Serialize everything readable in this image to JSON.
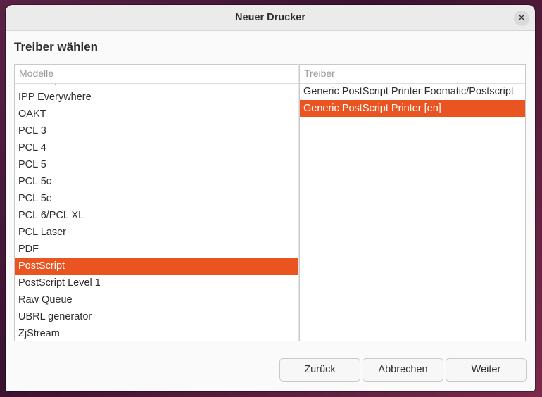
{
  "window": {
    "title": "Neuer Drucker",
    "close_symbol": "✕"
  },
  "page": {
    "heading": "Treiber wählen"
  },
  "models": {
    "header": "Modelle",
    "items": [
      "Postscript",
      "IPP Everywhere",
      "OAKT",
      "PCL 3",
      "PCL 4",
      "PCL 5",
      "PCL 5c",
      "PCL 5e",
      "PCL 6/PCL XL",
      "PCL Laser",
      "PDF",
      "PostScript",
      "PostScript Level 1",
      "Raw Queue",
      "UBRL generator",
      "ZjStream"
    ],
    "selected_index": 11
  },
  "drivers": {
    "header": "Treiber",
    "items": [
      "Generic PostScript Printer Foomatic/Postscript",
      "Generic PostScript Printer [en]"
    ],
    "selected_index": 1
  },
  "buttons": {
    "back": "Zurück",
    "cancel": "Abbrechen",
    "next": "Weiter"
  },
  "colors": {
    "accent": "#e95420"
  }
}
